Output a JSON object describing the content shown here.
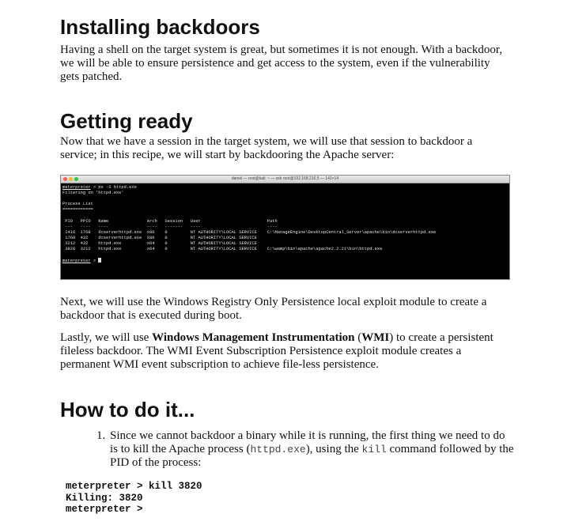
{
  "section1": {
    "heading": "Installing backdoors",
    "paragraph": "Having a shell on the target system is great, but sometimes it is not enough. With a backdoor, we will be able to ensure persistence and get access to the system, even if the vulnerability gets patched."
  },
  "section2": {
    "heading": "Getting ready",
    "paragraph": "Now that we have a session in the target system, we will use that session to backdoor a service; in this recipe, we will start by backdooring the Apache server:"
  },
  "terminal": {
    "title": "daniel — root@kali: ~ — ssh root@192.168.216.5 — 141×14",
    "prompt": "meterpreter",
    "command": " > ps -S httpd.exe",
    "filtering": "Filtering on 'httpd.exe'",
    "list_title": "Process List",
    "list_rule": "============",
    "columns": [
      "PID",
      "PPID",
      "Name",
      "Arch",
      "Session",
      "User",
      "Path"
    ],
    "rules": [
      "---",
      "----",
      "----",
      "----",
      "-------",
      "----",
      "----"
    ],
    "rows": [
      [
        "1416",
        "1768",
        "dcserverhttpd.exe",
        "x86",
        "0",
        "NT AUTHORITY\\LOCAL SERVICE",
        "C:\\ManageEngine\\DesktopCentral_Server\\apache\\bin\\dcserverhttpd.exe"
      ],
      [
        "1768",
        "432",
        "dcserverhttpd.exe",
        "x86",
        "0",
        "NT AUTHORITY\\LOCAL SERVICE",
        ""
      ],
      [
        "3212",
        "432",
        "httpd.exe",
        "x64",
        "0",
        "NT AUTHORITY\\LOCAL SERVICE",
        ""
      ],
      [
        "3820",
        "3212",
        "httpd.exe",
        "x64",
        "0",
        "NT AUTHORITY\\LOCAL SERVICE",
        "C:\\wamp\\bin\\apache\\apache2.2.21\\bin\\httpd.exe"
      ]
    ],
    "final_prompt_suffix": " > "
  },
  "paragraph_next": "Next, we will use the Windows Registry Only Persistence local exploit module to create a backdoor that is executed during boot.",
  "paragraph_last": {
    "before": "Lastly, we will use ",
    "bold": "Windows Management Instrumentation",
    "middle": " (",
    "bold2": "WMI",
    "after": ") to create a persistent fileless backdoor. The WMI Event Subscription Persistence exploit module creates a permanent WMI event subscription to achieve file-less persistence."
  },
  "section3": {
    "heading": "How to do it...",
    "step_number": "1.",
    "step_before": "Since we cannot backdoor a binary while it is running, the first thing we need to do is to kill the Apache process (",
    "step_code1": "httpd.exe",
    "step_middle": "), using the ",
    "step_code2": "kill",
    "step_after": " command followed by the PID of the process:",
    "code_lines": [
      "meterpreter > kill 3820",
      "Killing: 3820",
      "meterpreter >"
    ]
  }
}
